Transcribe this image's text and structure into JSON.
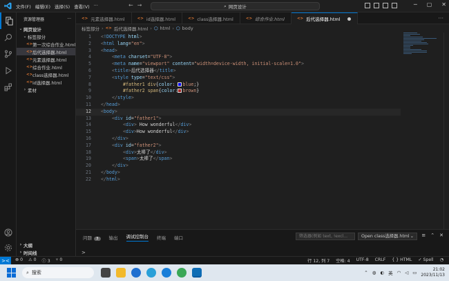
{
  "titlebar": {
    "menu": [
      "文件(F)",
      "编辑(E)",
      "选择(S)",
      "查看(V)",
      "···"
    ],
    "search_text": "网页设计",
    "nav_back": "←",
    "nav_forward": "→"
  },
  "sidebar": {
    "header": "资源管理器",
    "more": "···",
    "items": [
      {
        "label": "网页设计",
        "type": "folder-open",
        "depth": 0
      },
      {
        "label": "标签部分",
        "type": "folder-open",
        "depth": 1
      },
      {
        "label": "第一次综合作业.html",
        "type": "file",
        "depth": 2
      },
      {
        "label": "后代选择器.html",
        "type": "file",
        "depth": 2,
        "selected": true
      },
      {
        "label": "元素选择器.html",
        "type": "file",
        "depth": 2
      },
      {
        "label": "综合作业.html",
        "type": "file",
        "depth": 2
      },
      {
        "label": "class选择器.html",
        "type": "file",
        "depth": 2
      },
      {
        "label": "id选择器.html",
        "type": "file",
        "depth": 2
      },
      {
        "label": "素材",
        "type": "folder",
        "depth": 1
      }
    ],
    "outline": "大纲",
    "timeline": "时间线"
  },
  "tabs": [
    {
      "label": "元素选择器.html"
    },
    {
      "label": "id选择器.html"
    },
    {
      "label": "class选择器.html"
    },
    {
      "label": "综合作业.html",
      "italic": true
    },
    {
      "label": "后代选择器.html",
      "active": true,
      "dirty": true
    }
  ],
  "breadcrumb": [
    "标签部分",
    "后代选择器.html",
    "html",
    "body"
  ],
  "editor": {
    "current_line": 12,
    "lines": [
      {
        "n": "1",
        "tokens": [
          [
            "t-br",
            "<"
          ],
          [
            "t-tag",
            "!DOCTYPE"
          ],
          [
            "t-attr",
            " html"
          ],
          [
            "t-br",
            ">"
          ]
        ],
        "indent": 0
      },
      {
        "n": "2",
        "tokens": [
          [
            "t-br",
            "<"
          ],
          [
            "t-tag",
            "html"
          ],
          [
            "t-attr",
            " lang"
          ],
          [
            "t-txt",
            "="
          ],
          [
            "t-str",
            "\"en\""
          ],
          [
            "t-br",
            ">"
          ]
        ],
        "indent": 0
      },
      {
        "n": "3",
        "tokens": [
          [
            "t-br",
            "<"
          ],
          [
            "t-tag",
            "head"
          ],
          [
            "t-br",
            ">"
          ]
        ],
        "indent": 0
      },
      {
        "n": "4",
        "tokens": [
          [
            "t-br",
            "<"
          ],
          [
            "t-tag",
            "meta"
          ],
          [
            "t-attr",
            " charset"
          ],
          [
            "t-txt",
            "="
          ],
          [
            "t-str",
            "\"UTF-8\""
          ],
          [
            "t-br",
            ">"
          ]
        ],
        "indent": 1
      },
      {
        "n": "5",
        "tokens": [
          [
            "t-br",
            "<"
          ],
          [
            "t-tag",
            "meta"
          ],
          [
            "t-attr",
            " name"
          ],
          [
            "t-txt",
            "="
          ],
          [
            "t-str",
            "\"viewport\""
          ],
          [
            "t-attr",
            " content"
          ],
          [
            "t-txt",
            "="
          ],
          [
            "t-str",
            "\"width=device-width, initial-scale=1.0\""
          ],
          [
            "t-br",
            ">"
          ]
        ],
        "indent": 1
      },
      {
        "n": "6",
        "tokens": [
          [
            "t-br",
            "<"
          ],
          [
            "t-tag",
            "title"
          ],
          [
            "t-br",
            ">"
          ],
          [
            "t-txt",
            "后代选择器"
          ],
          [
            "t-br",
            "</"
          ],
          [
            "t-tag",
            "title"
          ],
          [
            "t-br",
            ">"
          ]
        ],
        "indent": 1
      },
      {
        "n": "7",
        "tokens": [
          [
            "t-br",
            "<"
          ],
          [
            "t-tag",
            "style"
          ],
          [
            "t-attr",
            " type"
          ],
          [
            "t-txt",
            "="
          ],
          [
            "t-str",
            "\"text/css\""
          ],
          [
            "t-br",
            ">"
          ]
        ],
        "indent": 1
      },
      {
        "n": "8",
        "tokens": [
          [
            "t-sel",
            "#father1 div"
          ],
          [
            "t-txt",
            "{"
          ],
          [
            "t-prop",
            "color"
          ],
          [
            "t-txt",
            ": "
          ],
          [
            "swatch",
            "#0000ff"
          ],
          [
            "t-val",
            "blue"
          ],
          [
            "t-txt",
            ";}"
          ]
        ],
        "indent": 2
      },
      {
        "n": "9",
        "tokens": [
          [
            "t-sel",
            "#father2 span"
          ],
          [
            "t-txt",
            "{"
          ],
          [
            "t-prop",
            "color"
          ],
          [
            "t-txt",
            ":"
          ],
          [
            "swatch",
            "#a52a2a"
          ],
          [
            "t-val",
            "brown"
          ],
          [
            "t-txt",
            "}"
          ]
        ],
        "indent": 2
      },
      {
        "n": "10",
        "tokens": [
          [
            "t-br",
            "</"
          ],
          [
            "t-tag",
            "style"
          ],
          [
            "t-br",
            ">"
          ]
        ],
        "indent": 1
      },
      {
        "n": "11",
        "tokens": [
          [
            "t-br",
            "</"
          ],
          [
            "t-tag",
            "head"
          ],
          [
            "t-br",
            ">"
          ]
        ],
        "indent": 0
      },
      {
        "n": "12",
        "tokens": [
          [
            "t-br",
            "<"
          ],
          [
            "t-tag",
            "body"
          ],
          [
            "t-br",
            ">"
          ]
        ],
        "indent": 0
      },
      {
        "n": "13",
        "tokens": [
          [
            "t-br",
            "<"
          ],
          [
            "t-tag",
            "div"
          ],
          [
            "t-attr",
            " id"
          ],
          [
            "t-txt",
            "="
          ],
          [
            "t-str",
            "\"father1\""
          ],
          [
            "t-br",
            ">"
          ]
        ],
        "indent": 1
      },
      {
        "n": "14",
        "tokens": [
          [
            "t-br",
            "<"
          ],
          [
            "t-tag",
            "div"
          ],
          [
            "t-br",
            ">"
          ],
          [
            "t-txt",
            " How wonderful"
          ],
          [
            "t-br",
            "</"
          ],
          [
            "t-tag",
            "div"
          ],
          [
            "t-br",
            ">"
          ]
        ],
        "indent": 2
      },
      {
        "n": "15",
        "tokens": [
          [
            "t-br",
            "<"
          ],
          [
            "t-tag",
            "div"
          ],
          [
            "t-br",
            ">"
          ],
          [
            "t-txt",
            "How wonderful"
          ],
          [
            "t-br",
            "</"
          ],
          [
            "t-tag",
            "div"
          ],
          [
            "t-br",
            ">"
          ]
        ],
        "indent": 2
      },
      {
        "n": "16",
        "tokens": [
          [
            "t-br",
            "</"
          ],
          [
            "t-tag",
            "div"
          ],
          [
            "t-br",
            ">"
          ]
        ],
        "indent": 1
      },
      {
        "n": "17",
        "tokens": [
          [
            "t-br",
            "<"
          ],
          [
            "t-tag",
            "div"
          ],
          [
            "t-attr",
            " id"
          ],
          [
            "t-txt",
            "="
          ],
          [
            "t-str",
            "\"father2\""
          ],
          [
            "t-br",
            ">"
          ]
        ],
        "indent": 1
      },
      {
        "n": "18",
        "tokens": [
          [
            "t-br",
            "<"
          ],
          [
            "t-tag",
            "div"
          ],
          [
            "t-br",
            ">"
          ],
          [
            "t-txt",
            "太棒了"
          ],
          [
            "t-br",
            "</"
          ],
          [
            "t-tag",
            "div"
          ],
          [
            "t-br",
            ">"
          ]
        ],
        "indent": 2
      },
      {
        "n": "19",
        "tokens": [
          [
            "t-br",
            "<"
          ],
          [
            "t-tag",
            "span"
          ],
          [
            "t-br",
            ">"
          ],
          [
            "t-txt",
            "太棒了"
          ],
          [
            "t-br",
            "</"
          ],
          [
            "t-tag",
            "span"
          ],
          [
            "t-br",
            ">"
          ]
        ],
        "indent": 2
      },
      {
        "n": "20",
        "tokens": [
          [
            "t-br",
            "</"
          ],
          [
            "t-tag",
            "div"
          ],
          [
            "t-br",
            ">"
          ]
        ],
        "indent": 1
      },
      {
        "n": "21",
        "tokens": [
          [
            "t-br",
            "</"
          ],
          [
            "t-tag",
            "body"
          ],
          [
            "t-br",
            ">"
          ]
        ],
        "indent": 0
      },
      {
        "n": "22",
        "tokens": [
          [
            "t-br",
            "</"
          ],
          [
            "t-tag",
            "html"
          ],
          [
            "t-br",
            ">"
          ]
        ],
        "indent": 0
      }
    ]
  },
  "panel": {
    "tabs": [
      "问题",
      "输出",
      "调试控制台",
      "终端",
      "端口"
    ],
    "problems_count": "3",
    "active_tab": "调试控制台",
    "filter_placeholder": "筛选器(例如 text, !excl...",
    "select_value": "Open class选择器.html",
    "prompt": ">"
  },
  "statusbar": {
    "remote": "><",
    "errors": "⊗ 0",
    "warnings": "⚠ 0",
    "info": "ⓘ 3",
    "ports": "⑂ 0",
    "position": "行 12, 列 7",
    "spaces": "空格: 4",
    "encoding": "UTF-8",
    "eol": "CRLF",
    "language": "{ } HTML",
    "spell": "✓ Spell",
    "bell": "🔔"
  },
  "taskbar": {
    "search": "搜索",
    "ime": "英",
    "time": "21:02",
    "date": "2023/11/13"
  },
  "colors": {
    "accent": "#0078d4",
    "html_icon": "#e37933",
    "editor_bg": "#1f1f1f"
  }
}
